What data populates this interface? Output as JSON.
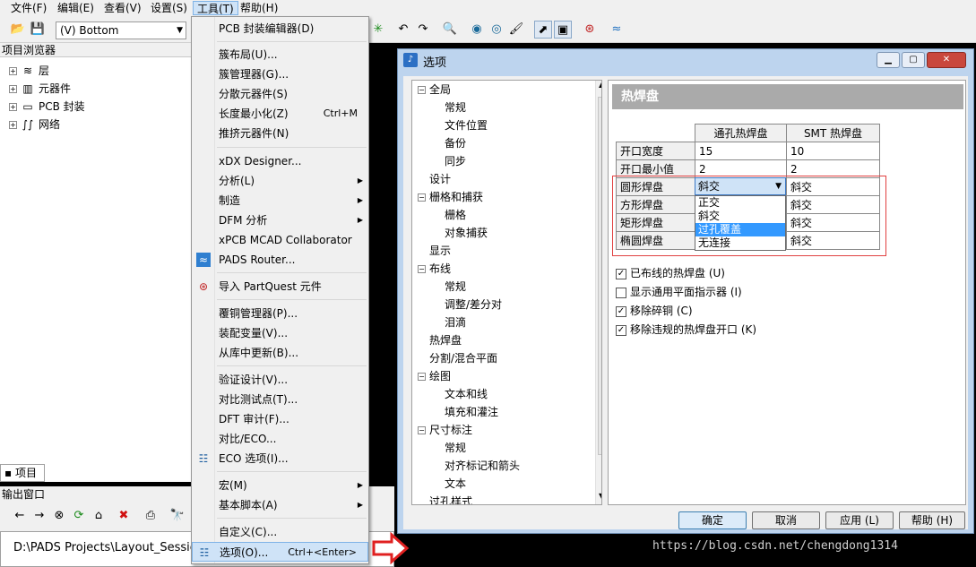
{
  "menubar": {
    "items": [
      "文件(F)",
      "编辑(E)",
      "查看(V)",
      "设置(S)",
      "工具(T)",
      "帮助(H)"
    ]
  },
  "toolbar": {
    "layer": "(V) Bottom"
  },
  "project_browser": {
    "title": "项目浏览器",
    "items": [
      "层",
      "元器件",
      "PCB 封装",
      "网络"
    ],
    "tab": "项目"
  },
  "output": {
    "title": "输出窗口",
    "content": "D:\\PADS Projects\\Layout_Session"
  },
  "tools_menu": {
    "items": [
      {
        "label": "PCB 封装编辑器(D)"
      },
      {
        "label": "簇布局(U)..."
      },
      {
        "label": "簇管理器(G)..."
      },
      {
        "label": "分散元器件(S)"
      },
      {
        "label": "长度最小化(Z)",
        "shortcut": "Ctrl+M"
      },
      {
        "label": "推挤元器件(N)"
      },
      {
        "label": "xDX Designer..."
      },
      {
        "label": "分析(L)"
      },
      {
        "label": "制造"
      },
      {
        "label": "DFM 分析"
      },
      {
        "label": "xPCB MCAD Collaborator"
      },
      {
        "label": "PADS Router..."
      },
      {
        "label": "导入 PartQuest 元件"
      },
      {
        "label": "覆铜管理器(P)..."
      },
      {
        "label": "装配变量(V)..."
      },
      {
        "label": "从库中更新(B)..."
      },
      {
        "label": "验证设计(V)..."
      },
      {
        "label": "对比测试点(T)..."
      },
      {
        "label": "DFT 审计(F)..."
      },
      {
        "label": "对比/ECO..."
      },
      {
        "label": "ECO 选项(I)..."
      },
      {
        "label": "宏(M)"
      },
      {
        "label": "基本脚本(A)"
      },
      {
        "label": "自定义(C)..."
      },
      {
        "label": "选项(O)...",
        "shortcut": "Ctrl+<Enter>"
      }
    ]
  },
  "dialog": {
    "title": "选项",
    "tree": [
      "全局",
      "常规",
      "文件位置",
      "备份",
      "同步",
      "设计",
      "栅格和捕获",
      "栅格",
      "对象捕获",
      "显示",
      "布线",
      "常规",
      "调整/差分对",
      "泪滴",
      "热焊盘",
      "分割/混合平面",
      "绘图",
      "文本和线",
      "填充和灌注",
      "尺寸标注",
      "常规",
      "对齐标记和箭头",
      "文本",
      "过孔样式"
    ],
    "panel_title": "热焊盘",
    "grid": {
      "headers": [
        "通孔热焊盘",
        "SMT 热焊盘"
      ],
      "rows": [
        {
          "label": "开口宽度",
          "thru": "15",
          "smt": "10"
        },
        {
          "label": "开口最小值",
          "thru": "2",
          "smt": "2"
        },
        {
          "label": "圆形焊盘",
          "thru": "斜交",
          "smt": "斜交"
        },
        {
          "label": "方形焊盘",
          "thru": "",
          "smt": "斜交"
        },
        {
          "label": "矩形焊盘",
          "thru": "",
          "smt": "斜交"
        },
        {
          "label": "椭圆焊盘",
          "thru": "",
          "smt": "斜交"
        }
      ]
    },
    "dropdown_options": [
      "正交",
      "斜交",
      "过孔覆盖",
      "无连接"
    ],
    "checkboxes": [
      {
        "label": "已布线的热焊盘 (U)",
        "checked": true
      },
      {
        "label": "显示通用平面指示器 (I)",
        "checked": false
      },
      {
        "label": "移除碎铜 (C)",
        "checked": true
      },
      {
        "label": "移除违规的热焊盘开口 (K)",
        "checked": true
      }
    ],
    "buttons": {
      "ok": "确定",
      "cancel": "取消",
      "apply": "应用 (L)",
      "help": "帮助 (H)"
    }
  },
  "watermark": "https://blog.csdn.net/chengdong1314"
}
